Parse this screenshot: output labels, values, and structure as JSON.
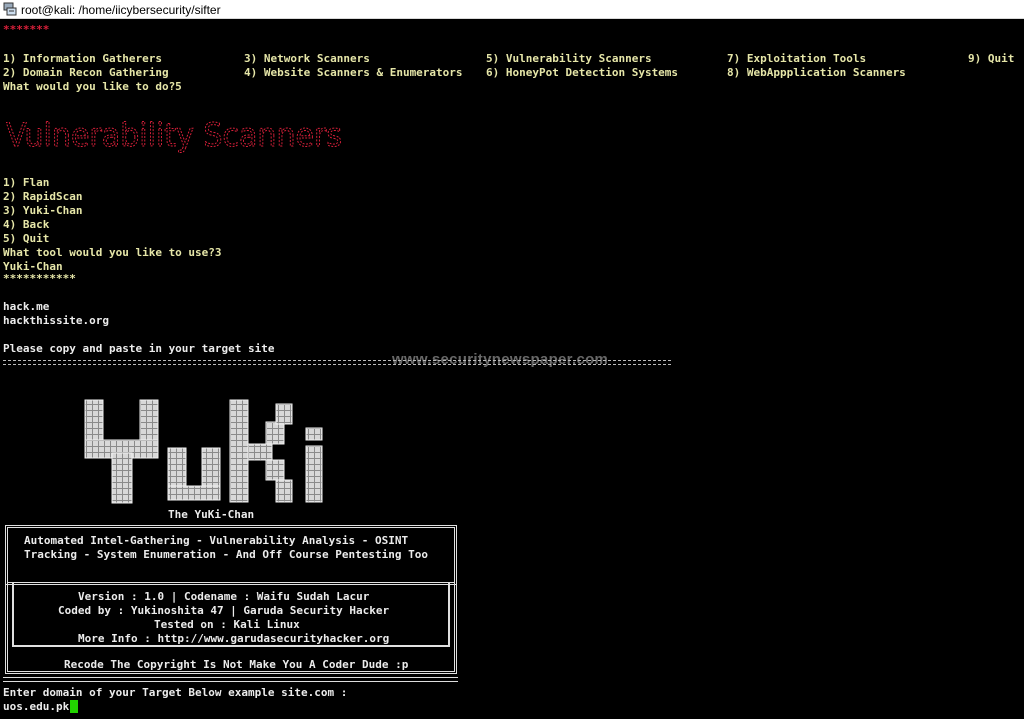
{
  "window": {
    "title": "root@kali: /home/iicybersecurity/sifter"
  },
  "terminal": {
    "stars_top": "*******",
    "menu": [
      {
        "label": "1) Information Gatherers"
      },
      {
        "label": "2) Domain Recon Gathering"
      },
      {
        "label": "3) Network Scanners"
      },
      {
        "label": "4) Website Scanners & Enumerators"
      },
      {
        "label": "5) Vulnerability Scanners"
      },
      {
        "label": "6) HoneyPot Detection Systems"
      },
      {
        "label": "7) Exploitation Tools"
      },
      {
        "label": "8) WebAppplication Scanners"
      },
      {
        "label": "9) Quit"
      }
    ],
    "prompt1": "What would you like to do?5",
    "banner": "Vulnerability Scanners",
    "tools": [
      "1) Flan",
      "2) RapidScan",
      "3) Yuki-Chan",
      "4) Back",
      "5) Quit"
    ],
    "prompt2": "What tool would you like to use?3",
    "selected_tool": "Yuki-Chan",
    "stars_mid": "***********",
    "targets": [
      "hack.me",
      "hackthissite.org"
    ],
    "paste_prompt": "Please copy and paste in your target site",
    "watermark": "www.securitynewspaper.com",
    "yuki_caption": "The YuKi-Chan",
    "desc_lines": [
      "Automated Intel-Gathering - Vulnerability Analysis - OSINT",
      "Tracking - System Enumeration - And Off Course Pentesting Too"
    ],
    "info_lines": [
      "Version : 1.0 | Codename : Waifu Sudah Lacur",
      "Coded by : Yukinoshita 47 | Garuda Security Hacker",
      "Tested on : Kali Linux",
      "More Info : http://www.garudasecurityhacker.org"
    ],
    "recode": "Recode The Copyright Is Not Make You A Coder Dude :p",
    "enter_prompt": "Enter domain of your Target Below example site.com :",
    "input_value": "uos.edu.pk"
  },
  "colors": {
    "menu_text": "#e6e6a8",
    "banner_red": "#d8203a",
    "cursor": "#22d400"
  }
}
